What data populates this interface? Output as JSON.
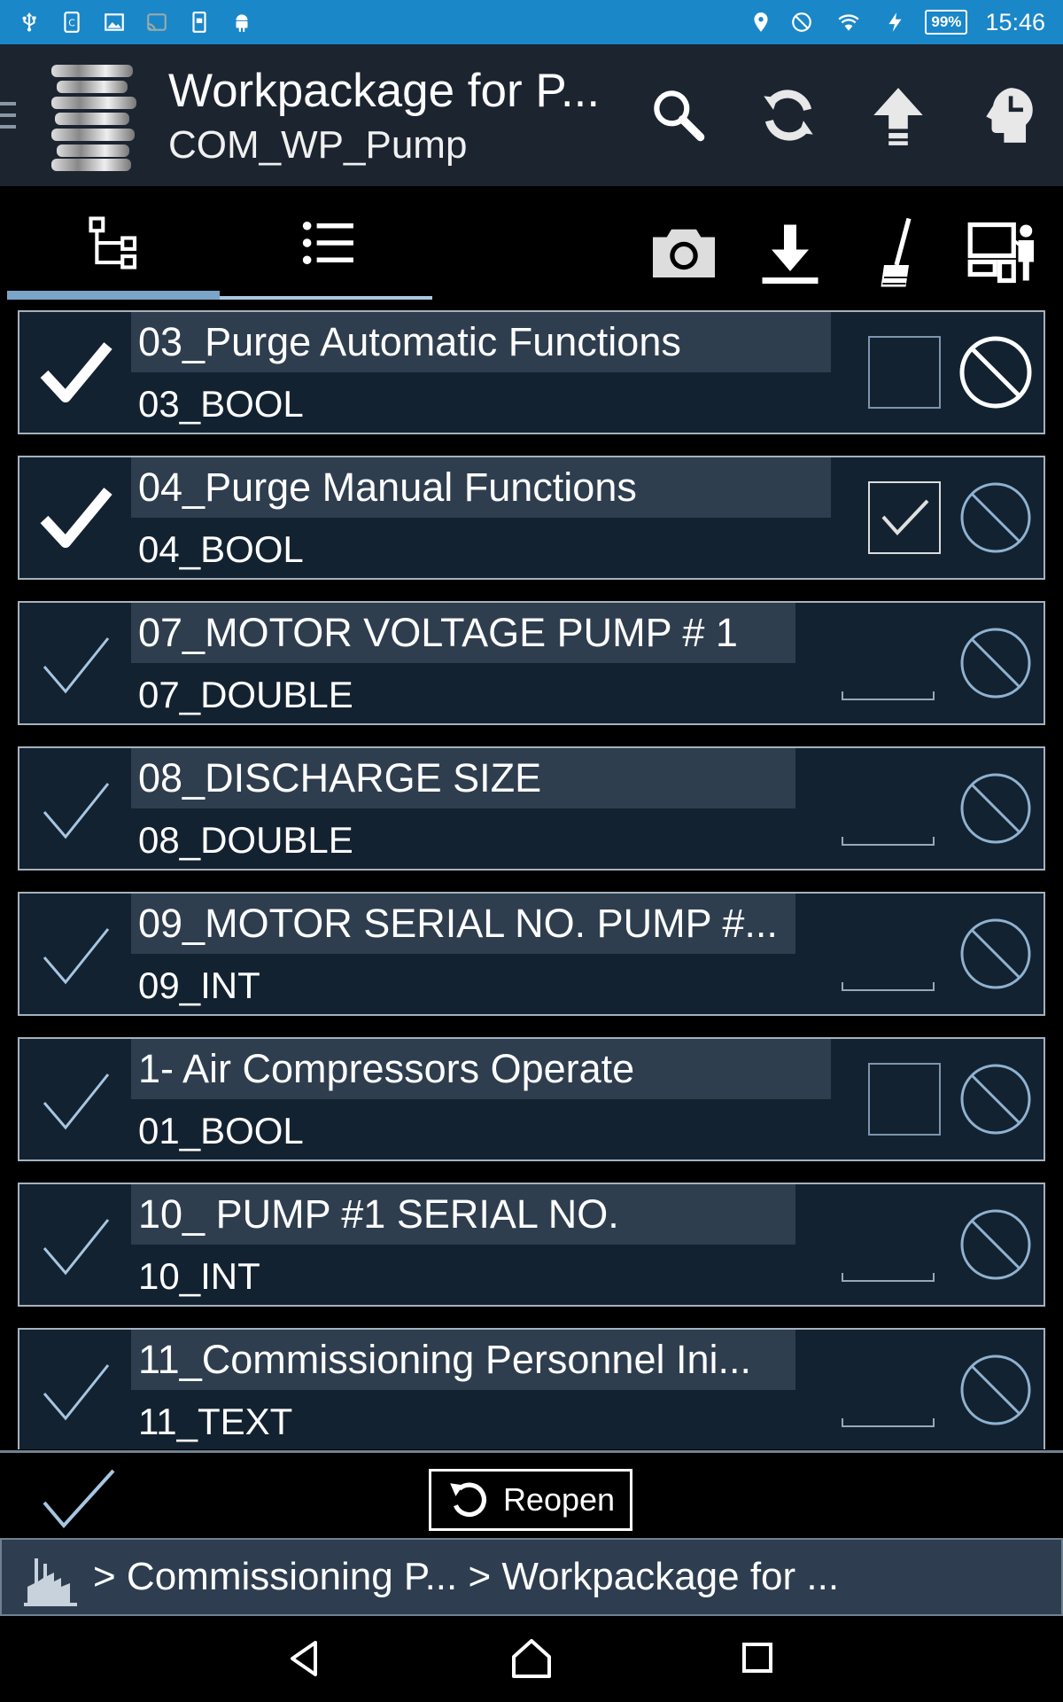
{
  "status_bar": {
    "left_icons": [
      "usb-icon",
      "sim-icon",
      "image-icon",
      "cast-icon",
      "save-icon",
      "android-icon"
    ],
    "right_icons": [
      "location-icon",
      "blocked-icon",
      "wifi-icon",
      "charging-icon"
    ],
    "battery": "99%",
    "time": "15:46"
  },
  "app_bar": {
    "title": "Workpackage for P...",
    "subtitle": "COM_WP_Pump",
    "actions": [
      "search-icon",
      "sync-icon",
      "upload-icon",
      "head-icon"
    ]
  },
  "tabs": [
    {
      "icon": "tree-icon",
      "active": true
    },
    {
      "icon": "list-icon",
      "active": false
    }
  ],
  "tools": [
    "camera-icon",
    "download-icon",
    "broom-icon",
    "devices-icon"
  ],
  "items": [
    {
      "label": "03_Purge Automatic Functions",
      "type": "03_BOOL",
      "done": true,
      "field": "checkbox",
      "checked": false
    },
    {
      "label": "04_Purge Manual Functions",
      "type": "04_BOOL",
      "done": true,
      "field": "checkbox",
      "checked": true
    },
    {
      "label": "07_MOTOR VOLTAGE PUMP # 1",
      "type": "07_DOUBLE",
      "done": false,
      "field": "text",
      "checked": false
    },
    {
      "label": "08_DISCHARGE SIZE",
      "type": "08_DOUBLE",
      "done": false,
      "field": "text",
      "checked": false
    },
    {
      "label": "09_MOTOR SERIAL NO. PUMP #...",
      "type": "09_INT",
      "done": false,
      "field": "text",
      "checked": false
    },
    {
      "label": "1-  Air Compressors Operate",
      "type": "01_BOOL",
      "done": false,
      "field": "checkbox",
      "checked": false
    },
    {
      "label": "10_ PUMP #1 SERIAL NO.",
      "type": "10_INT",
      "done": false,
      "field": "text",
      "checked": false
    },
    {
      "label": "11_Commissioning Personnel Ini...",
      "type": "11_TEXT",
      "done": false,
      "field": "text",
      "checked": false
    }
  ],
  "action_bar": {
    "reopen_label": "Reopen"
  },
  "breadcrumb": {
    "text": ">  Commissioning P... > Workpackage for ..."
  },
  "colors": {
    "status_bar": "#1a87c9",
    "app_bar": "#1c2430",
    "row_bg": "#132231",
    "label_bg": "#2e3e4f"
  }
}
